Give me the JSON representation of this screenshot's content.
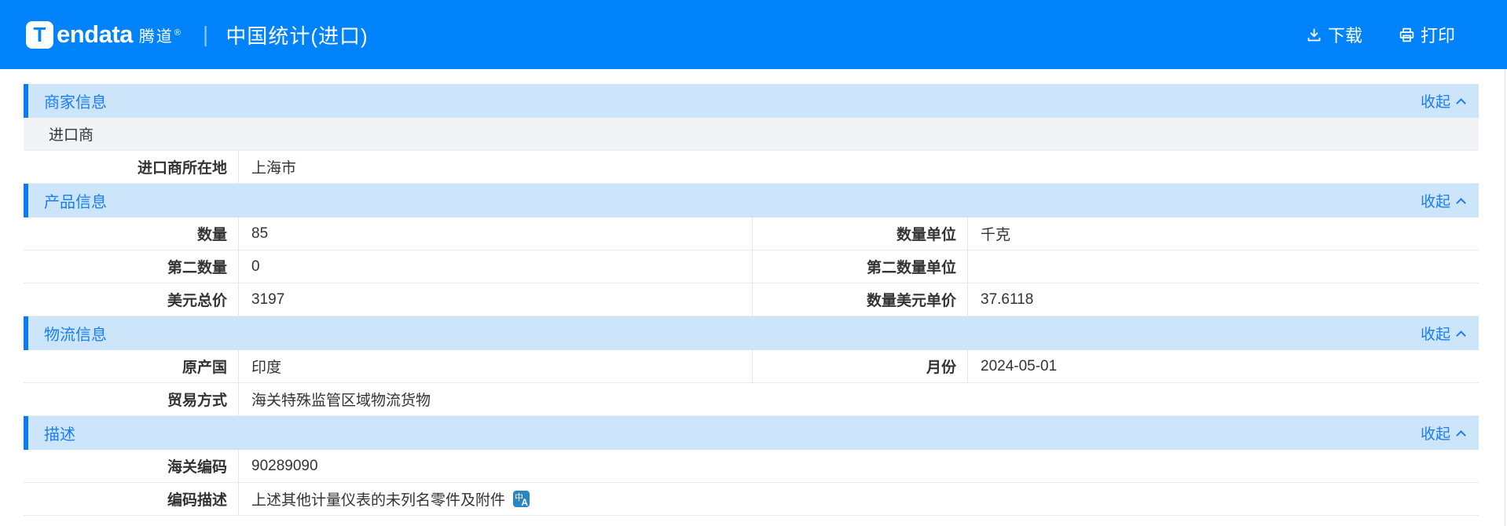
{
  "app_bar": {
    "logo": {
      "initial": "T",
      "text": "endata",
      "cn": "腾道",
      "reg": "®"
    },
    "divider": "|",
    "title": "中国统计(进口)",
    "actions": {
      "download": "下载",
      "print": "打印"
    }
  },
  "sections": {
    "merchant": {
      "title": "商家信息",
      "collapse": "收起",
      "importer_label": "进口商",
      "rows": {
        "location": {
          "label": "进口商所在地",
          "value": "上海市"
        }
      }
    },
    "product": {
      "title": "产品信息",
      "collapse": "收起",
      "rows": {
        "quantity": {
          "label": "数量",
          "value": "85"
        },
        "quantity_unit": {
          "label": "数量单位",
          "value": "千克"
        },
        "second_quantity": {
          "label": "第二数量",
          "value": "0"
        },
        "second_quantity_unit": {
          "label": "第二数量单位",
          "value": ""
        },
        "usd_total": {
          "label": "美元总价",
          "value": "3197"
        },
        "usd_unit_price": {
          "label": "数量美元单价",
          "value": "37.6118"
        }
      }
    },
    "logistics": {
      "title": "物流信息",
      "collapse": "收起",
      "rows": {
        "origin_country": {
          "label": "原产国",
          "value": "印度"
        },
        "month": {
          "label": "月份",
          "value": "2024-05-01"
        },
        "trade_mode": {
          "label": "贸易方式",
          "value": "海关特殊监管区域物流货物"
        }
      }
    },
    "description": {
      "title": "描述",
      "collapse": "收起",
      "rows": {
        "hs_code": {
          "label": "海关编码",
          "value": "90289090"
        },
        "code_description": {
          "label": "编码描述",
          "value": "上述其他计量仪表的未列名零件及附件"
        }
      }
    }
  },
  "icons": {
    "download": "download-icon",
    "print": "print-icon",
    "collapse": "chevron-up-icon",
    "translate": "translate-icon",
    "translate_glyphs": {
      "top": "中",
      "bottom": "A"
    }
  },
  "colors": {
    "app_bar": "#0083fa",
    "section_header_bg": "#cde5fb",
    "accent": "#1a7ef2",
    "left_stripe": "#0a7bf0",
    "grey_row_bg": "#f2f3f6",
    "row_border": "#e9ebee",
    "text": "#333333",
    "translate_bg": "#2b85c4"
  }
}
